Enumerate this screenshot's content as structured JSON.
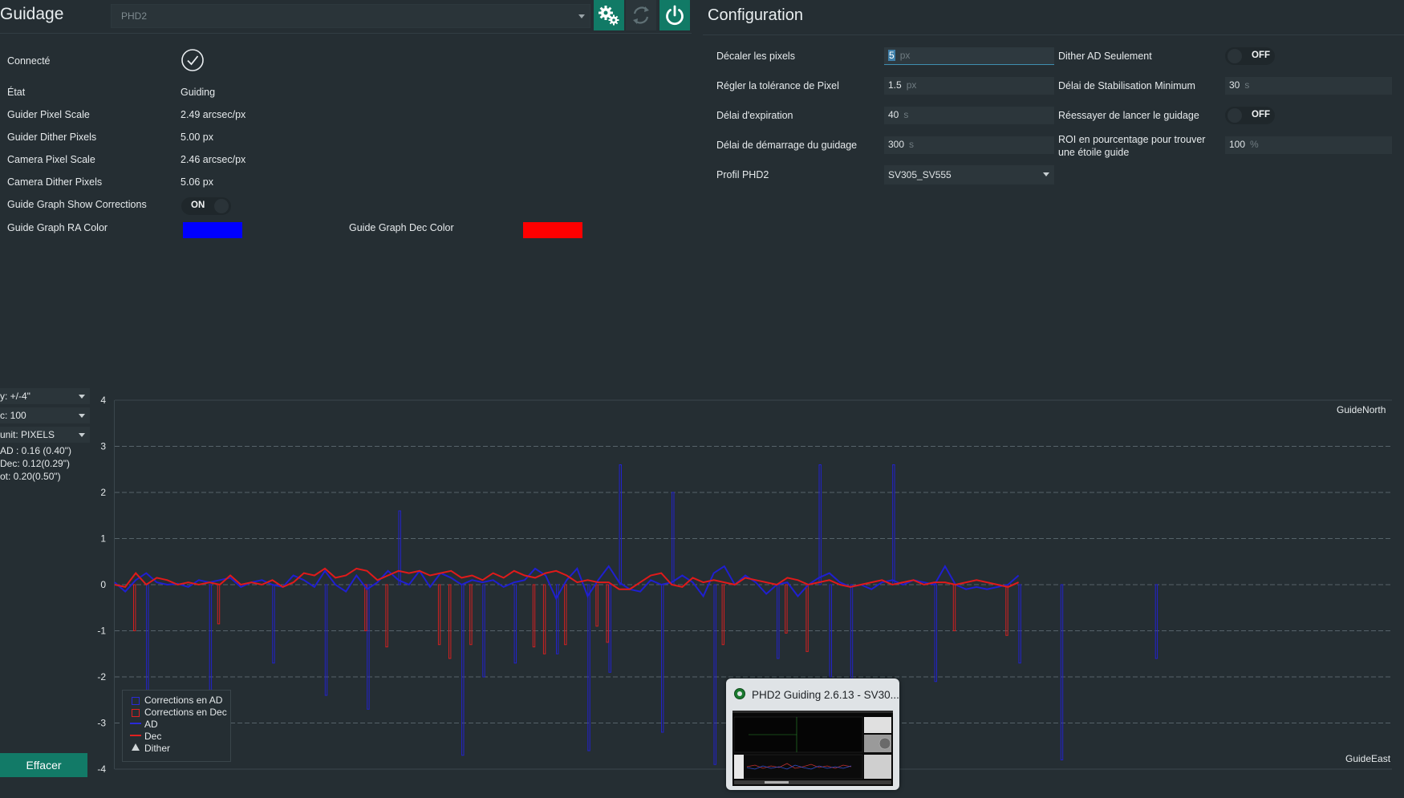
{
  "guiding": {
    "title": "Guidage",
    "guider_select": "PHD2",
    "settings_icon": "gears-icon",
    "refresh_icon": "refresh-icon",
    "power_icon": "power-icon",
    "rows": [
      {
        "label": "Connecté",
        "value": ""
      },
      {
        "label": "État",
        "value": "Guiding"
      },
      {
        "label": "Guider Pixel Scale",
        "value": "2.49 arcsec/px"
      },
      {
        "label": "Guider Dither Pixels",
        "value": "5.00 px"
      },
      {
        "label": "Camera Pixel Scale",
        "value": "2.46 arcsec/px"
      },
      {
        "label": "Camera Dither Pixels",
        "value": "5.06 px"
      }
    ],
    "show_corrections_label": "Guide Graph Show Corrections",
    "show_corrections_toggle": "ON",
    "ra_color_label": "Guide Graph RA Color",
    "ra_color": "#0000ff",
    "dec_color_label": "Guide Graph Dec Color",
    "dec_color": "#ff0000"
  },
  "configuration": {
    "title": "Configuration",
    "left_rows": [
      {
        "label": "Décaler les pixels",
        "value": "5",
        "unit": "px"
      },
      {
        "label": "Régler la tolérance de Pixel",
        "value": "1.5",
        "unit": "px"
      },
      {
        "label": "Délai d'expiration",
        "value": "40",
        "unit": "s"
      },
      {
        "label": "Délai de démarrage du guidage",
        "value": "300",
        "unit": "s"
      }
    ],
    "profile_label": "Profil PHD2",
    "profile_value": "SV305_SV555",
    "right_rows": [
      {
        "label": "Dither AD Seulement",
        "toggle": "OFF"
      },
      {
        "label": "Délai de Stabilisation Minimum",
        "value": "30",
        "unit": "s"
      },
      {
        "label": "Réessayer de lancer le guidage",
        "toggle": "OFF"
      },
      {
        "label": "ROI en pourcentage pour trouver une étoile guide",
        "value": "100",
        "unit": "%"
      }
    ]
  },
  "graph_controls": {
    "y_scale": "y: +/-4\"",
    "x_count": "c: 100",
    "unit": "unit: PIXELS",
    "rms_ra": "AD : 0.16 (0.40\")",
    "rms_dec": "Dec: 0.12(0.29\")",
    "rms_tot": "ot: 0.20(0.50\")",
    "clear_button": "Effacer"
  },
  "legend": {
    "ra_corr": "Corrections en AD",
    "dec_corr": "Corrections en Dec",
    "ra": "AD",
    "dec": "Dec",
    "dither": "Dither"
  },
  "taskbar_preview": {
    "title": "PHD2 Guiding 2.6.13 - SV30..."
  },
  "chart_data": {
    "type": "line",
    "y_ticks": [
      "4",
      "3",
      "2",
      "1",
      "0",
      "-1",
      "-2",
      "-3",
      "-4"
    ],
    "ylim": [
      -4,
      4
    ],
    "xlim": [
      0,
      100
    ],
    "grid": true,
    "top_right_label": "GuideNorth",
    "bottom_right_label": "GuideEast",
    "series": [
      {
        "name": "AD",
        "color": "#1f1fd0",
        "values": [
          0.05,
          -0.15,
          0.1,
          0.25,
          0.05,
          0.0,
          0.02,
          -0.05,
          0.1,
          0.05,
          0.1,
          0.15,
          -0.05,
          0.05,
          0.1,
          0.0,
          -0.05,
          0.2,
          0.1,
          -0.05,
          0.3,
          0.0,
          -0.15,
          0.2,
          -0.1,
          0.05,
          0.3,
          0.1,
          0.0,
          0.3,
          -0.05,
          0.25,
          0.15,
          0.0,
          0.1,
          0.05,
          0.1,
          -0.05,
          0.05,
          0.1,
          0.35,
          0.2,
          -0.3,
          0.1,
          0.35,
          -0.25,
          0.1,
          0.4,
          0.05,
          -0.1,
          -0.15,
          0.1,
          0.0,
          0.05,
          0.2,
          0.05,
          -0.25,
          0.25,
          0.4,
          0.0,
          0.2,
          0.05,
          -0.2,
          0.0,
          0.05,
          -0.25,
          0.0,
          0.15,
          0.25,
          0.05,
          -0.05,
          0.0,
          -0.1,
          0.05,
          0.1,
          0.0,
          0.1,
          0.05,
          0.0,
          0.4,
          0.0,
          -0.1,
          -0.05,
          -0.1,
          -0.05,
          0.0,
          0.2
        ]
      },
      {
        "name": "Dec",
        "color": "#e01a1a",
        "values": [
          0.0,
          -0.05,
          0.25,
          0.0,
          0.15,
          0.1,
          0.0,
          0.05,
          0.0,
          0.05,
          0.0,
          0.2,
          0.0,
          0.05,
          0.0,
          0.1,
          -0.05,
          0.05,
          0.25,
          0.2,
          0.35,
          0.15,
          0.2,
          0.35,
          0.3,
          0.1,
          0.2,
          0.3,
          0.25,
          0.3,
          0.2,
          0.25,
          0.3,
          0.15,
          0.2,
          0.1,
          0.25,
          0.15,
          0.3,
          0.2,
          0.15,
          0.25,
          0.3,
          0.2,
          0.05,
          0.1,
          0.05,
          0.05,
          -0.1,
          -0.1,
          0.05,
          0.2,
          0.25,
          0.0,
          -0.05,
          0.15,
          0.05,
          0.1,
          0.05,
          0.0,
          0.15,
          0.1,
          0.05,
          0.0,
          0.15,
          0.1,
          0.0,
          0.05,
          0.1,
          0.0,
          -0.05,
          0.0,
          0.05,
          0.1,
          0.0,
          0.05,
          0.1,
          0.0,
          0.05,
          0.05,
          0.0,
          0.05,
          0.1,
          0.05,
          0.0,
          -0.05,
          0.05
        ]
      }
    ],
    "ra_corrections": [
      [
        3,
        -2.3
      ],
      [
        9,
        -2.4
      ],
      [
        15,
        -1.7
      ],
      [
        20,
        -2.4
      ],
      [
        24,
        -2.7
      ],
      [
        27,
        1.6
      ],
      [
        33,
        -3.7
      ],
      [
        35,
        -2.0
      ],
      [
        38,
        -1.7
      ],
      [
        42,
        -1.5
      ],
      [
        45,
        -3.6
      ],
      [
        47,
        -1.9
      ],
      [
        48,
        2.6
      ],
      [
        52,
        -3.2
      ],
      [
        53,
        2.0
      ],
      [
        57,
        -3.9
      ],
      [
        63,
        -1.6
      ],
      [
        67,
        2.6
      ],
      [
        68,
        -2.0
      ],
      [
        70,
        -2.1
      ],
      [
        74,
        2.6
      ],
      [
        78,
        -2.1
      ],
      [
        86,
        -1.7
      ],
      [
        90,
        -3.8
      ],
      [
        99,
        -1.6
      ]
    ],
    "dec_corrections": [
      [
        2,
        -1.0
      ],
      [
        10,
        -0.85
      ],
      [
        24,
        -1.0
      ],
      [
        26,
        -1.35
      ],
      [
        31,
        -1.3
      ],
      [
        32,
        -1.6
      ],
      [
        34,
        -1.3
      ],
      [
        40,
        -1.35
      ],
      [
        41,
        -1.5
      ],
      [
        43,
        -1.3
      ],
      [
        46,
        -0.9
      ],
      [
        47,
        -1.25
      ],
      [
        58,
        -1.3
      ],
      [
        64,
        -1.05
      ],
      [
        66,
        -1.45
      ],
      [
        80,
        -1.0
      ],
      [
        85,
        -1.1
      ]
    ]
  }
}
